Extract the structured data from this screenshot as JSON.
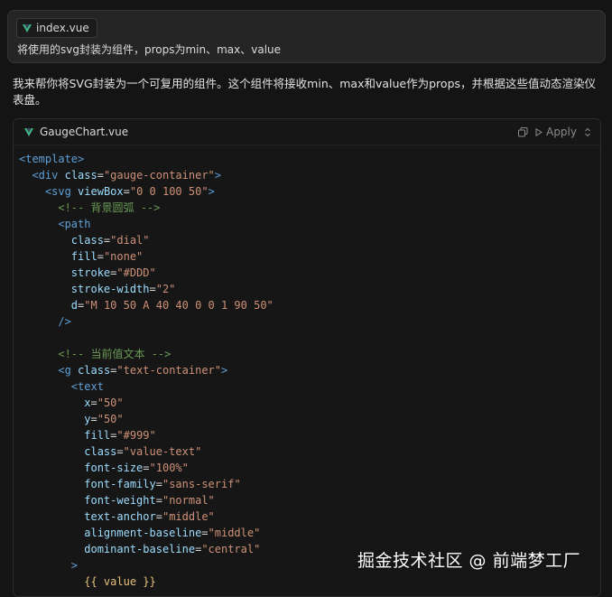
{
  "prompt": {
    "file_chip": "index.vue",
    "icon": "vue-icon",
    "text": "将使用的svg封装为组件，props为min、max、value"
  },
  "answer": {
    "text": "我来帮你将SVG封装为一个可复用的组件。这个组件将接收min、max和value作为props，并根据这些值动态渲染仪表盘。"
  },
  "code_block": {
    "filename": "GaugeChart.vue",
    "icon": "vue-icon",
    "copy_icon": "copy-icon",
    "apply_label": "Apply",
    "expand_icon": "chevron-updown-icon",
    "lines": [
      [
        [
          "tag",
          "<template>"
        ]
      ],
      [
        [
          "txt",
          "  "
        ],
        [
          "tag",
          "<div"
        ],
        [
          "txt",
          " "
        ],
        [
          "attr",
          "class"
        ],
        [
          "eq",
          "="
        ],
        [
          "str",
          "\"gauge-container\""
        ],
        [
          "tag",
          ">"
        ]
      ],
      [
        [
          "txt",
          "    "
        ],
        [
          "tag",
          "<svg"
        ],
        [
          "txt",
          " "
        ],
        [
          "attr",
          "viewBox"
        ],
        [
          "eq",
          "="
        ],
        [
          "str",
          "\"0 0 100 50\""
        ],
        [
          "tag",
          ">"
        ]
      ],
      [
        [
          "txt",
          "      "
        ],
        [
          "cmt",
          "<!-- 背景圆弧 -->"
        ]
      ],
      [
        [
          "txt",
          "      "
        ],
        [
          "tag",
          "<path"
        ]
      ],
      [
        [
          "txt",
          "        "
        ],
        [
          "attr",
          "class"
        ],
        [
          "eq",
          "="
        ],
        [
          "str",
          "\"dial\""
        ]
      ],
      [
        [
          "txt",
          "        "
        ],
        [
          "attr",
          "fill"
        ],
        [
          "eq",
          "="
        ],
        [
          "str",
          "\"none\""
        ]
      ],
      [
        [
          "txt",
          "        "
        ],
        [
          "attr",
          "stroke"
        ],
        [
          "eq",
          "="
        ],
        [
          "str",
          "\"#DDD\""
        ]
      ],
      [
        [
          "txt",
          "        "
        ],
        [
          "attr",
          "stroke-width"
        ],
        [
          "eq",
          "="
        ],
        [
          "str",
          "\"2\""
        ]
      ],
      [
        [
          "txt",
          "        "
        ],
        [
          "attr",
          "d"
        ],
        [
          "eq",
          "="
        ],
        [
          "str",
          "\"M 10 50 A 40 40 0 0 1 90 50\""
        ]
      ],
      [
        [
          "txt",
          "      "
        ],
        [
          "tag",
          "/>"
        ]
      ],
      [
        [
          "txt",
          ""
        ]
      ],
      [
        [
          "txt",
          "      "
        ],
        [
          "cmt",
          "<!-- 当前值文本 -->"
        ]
      ],
      [
        [
          "txt",
          "      "
        ],
        [
          "tag",
          "<g"
        ],
        [
          "txt",
          " "
        ],
        [
          "attr",
          "class"
        ],
        [
          "eq",
          "="
        ],
        [
          "str",
          "\"text-container\""
        ],
        [
          "tag",
          ">"
        ]
      ],
      [
        [
          "txt",
          "        "
        ],
        [
          "tag",
          "<text"
        ]
      ],
      [
        [
          "txt",
          "          "
        ],
        [
          "attr",
          "x"
        ],
        [
          "eq",
          "="
        ],
        [
          "str",
          "\"50\""
        ]
      ],
      [
        [
          "txt",
          "          "
        ],
        [
          "attr",
          "y"
        ],
        [
          "eq",
          "="
        ],
        [
          "str",
          "\"50\""
        ]
      ],
      [
        [
          "txt",
          "          "
        ],
        [
          "attr",
          "fill"
        ],
        [
          "eq",
          "="
        ],
        [
          "str",
          "\"#999\""
        ]
      ],
      [
        [
          "txt",
          "          "
        ],
        [
          "attr",
          "class"
        ],
        [
          "eq",
          "="
        ],
        [
          "str",
          "\"value-text\""
        ]
      ],
      [
        [
          "txt",
          "          "
        ],
        [
          "attr",
          "font-size"
        ],
        [
          "eq",
          "="
        ],
        [
          "str",
          "\"100%\""
        ]
      ],
      [
        [
          "txt",
          "          "
        ],
        [
          "attr",
          "font-family"
        ],
        [
          "eq",
          "="
        ],
        [
          "str",
          "\"sans-serif\""
        ]
      ],
      [
        [
          "txt",
          "          "
        ],
        [
          "attr",
          "font-weight"
        ],
        [
          "eq",
          "="
        ],
        [
          "str",
          "\"normal\""
        ]
      ],
      [
        [
          "txt",
          "          "
        ],
        [
          "attr",
          "text-anchor"
        ],
        [
          "eq",
          "="
        ],
        [
          "str",
          "\"middle\""
        ]
      ],
      [
        [
          "txt",
          "          "
        ],
        [
          "attr",
          "alignment-baseline"
        ],
        [
          "eq",
          "="
        ],
        [
          "str",
          "\"middle\""
        ]
      ],
      [
        [
          "txt",
          "          "
        ],
        [
          "attr",
          "dominant-baseline"
        ],
        [
          "eq",
          "="
        ],
        [
          "str",
          "\"central\""
        ]
      ],
      [
        [
          "txt",
          "        "
        ],
        [
          "tag",
          ">"
        ]
      ],
      [
        [
          "txt",
          "          "
        ],
        [
          "mus",
          "{{ value }}"
        ]
      ]
    ]
  },
  "watermark": {
    "text": "掘金技术社区 @ 前端梦工厂"
  }
}
